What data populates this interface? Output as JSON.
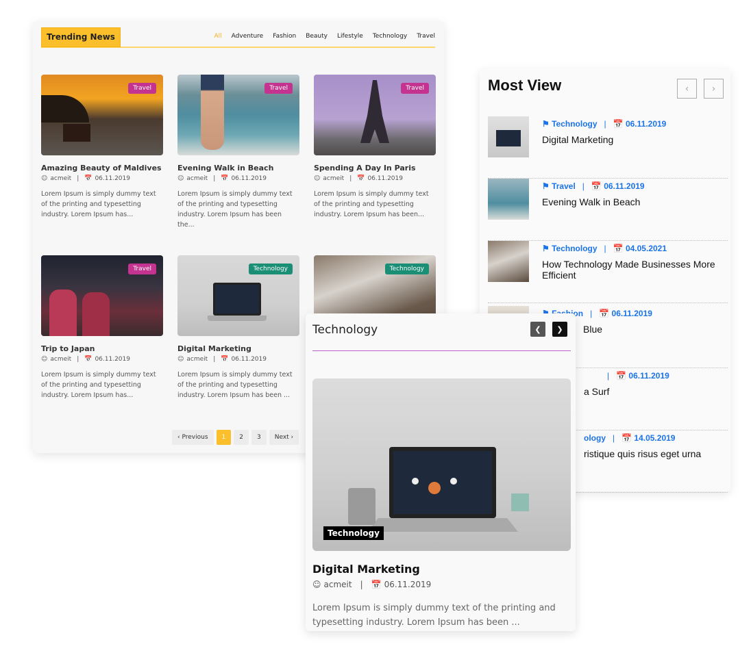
{
  "trending": {
    "title": "Trending News",
    "filters": [
      "All",
      "Adventure",
      "Fashion",
      "Beauty",
      "Lifestyle",
      "Technology",
      "Travel"
    ],
    "active_filter": "All",
    "posts": [
      {
        "title": "Amazing Beauty of Maldives",
        "author": "acmeit",
        "date": "06.11.2019",
        "category": "Travel",
        "excerpt": "Lorem Ipsum is simply dummy text of the printing and typesetting industry. Lorem Ipsum has..."
      },
      {
        "title": "Evening Walk in Beach",
        "author": "acmeit",
        "date": "06.11.2019",
        "category": "Travel",
        "excerpt": "Lorem Ipsum is simply dummy text of the printing and typesetting industry. Lorem Ipsum has been the..."
      },
      {
        "title": "Spending A Day In Paris",
        "author": "acmeit",
        "date": "06.11.2019",
        "category": "Travel",
        "excerpt": "Lorem Ipsum is simply dummy text of the printing and typesetting industry. Lorem Ipsum has been..."
      },
      {
        "title": "Trip to Japan",
        "author": "acmeit",
        "date": "06.11.2019",
        "category": "Travel",
        "excerpt": "Lorem Ipsum is simply dummy text of the printing and typesetting industry. Lorem Ipsum has..."
      },
      {
        "title": "Digital Marketing",
        "author": "acmeit",
        "date": "06.11.2019",
        "category": "Technology",
        "excerpt": "Lorem Ipsum is simply dummy text of the printing and typesetting industry. Lorem Ipsum has been ..."
      },
      {
        "title": "",
        "author": "",
        "date": "",
        "category": "Technology",
        "excerpt": ""
      }
    ],
    "pagination": {
      "previous": "Previous",
      "pages": [
        "1",
        "2",
        "3"
      ],
      "current": "1",
      "next": "Next"
    }
  },
  "most_view": {
    "title": "Most View",
    "items": [
      {
        "category": "Technology",
        "date": "06.11.2019",
        "title": "Digital Marketing"
      },
      {
        "category": "Travel",
        "date": "06.11.2019",
        "title": "Evening Walk in Beach"
      },
      {
        "category": "Technology",
        "date": "04.05.2021",
        "title": "How Technology Made Businesses More Efficient"
      },
      {
        "category": "Fashion",
        "date": "06.11.2019",
        "title": "Blue"
      },
      {
        "category": "",
        "date": "06.11.2019",
        "title": "a Surf"
      },
      {
        "category": "ology",
        "date": "14.05.2019",
        "title": "ristique quis risus eget urna"
      }
    ]
  },
  "tech_card": {
    "title": "Technology",
    "badge": "Technology",
    "post_title": "Digital Marketing",
    "author": "acmeit",
    "date": "06.11.2019",
    "excerpt": "Lorem Ipsum is simply dummy text of the printing and typesetting industry. Lorem Ipsum has been ..."
  },
  "colors": {
    "accent_yellow": "#fbbf2b",
    "travel_badge": "#c4338f",
    "tech_badge": "#1b8e76",
    "link_blue": "#1a73e8",
    "tech_divider": "#bf5fcf"
  }
}
